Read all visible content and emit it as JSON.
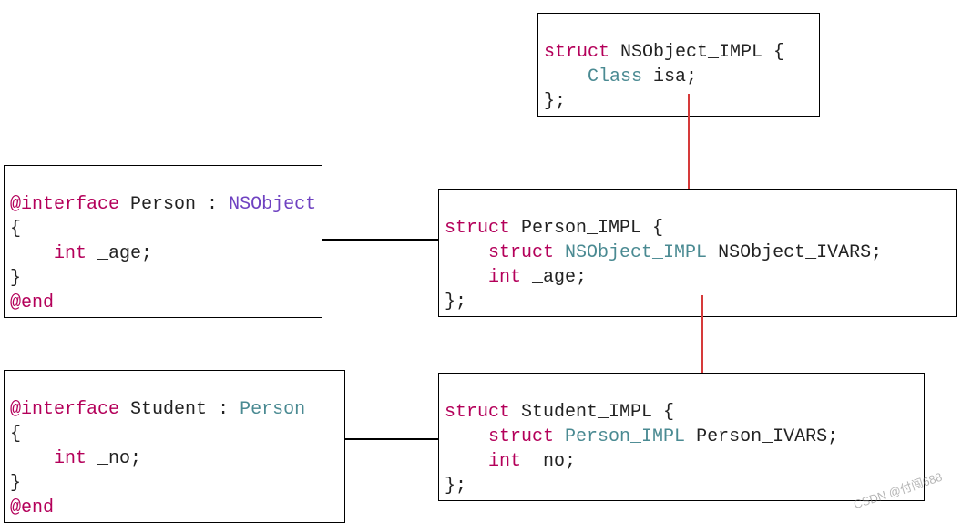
{
  "boxes": {
    "nsobject_impl": {
      "l1_struct": "struct",
      "l1_name": " NSObject_IMPL ",
      "l1_brace": "{",
      "l2_indent": "    ",
      "l2_type": "Class",
      "l2_ident": " isa;",
      "l3": "};"
    },
    "person_iface": {
      "l1_at": "@interface",
      "l1_name": " Person ",
      "l1_colon": ": ",
      "l1_super": "NSObject",
      "l2": "{",
      "l3_indent": "    ",
      "l3_kw": "int",
      "l3_ident": " _age;",
      "l4": "}",
      "l5_at": "@end"
    },
    "person_impl": {
      "l1_struct": "struct",
      "l1_name": " Person_IMPL ",
      "l1_brace": "{",
      "l2_indent": "    ",
      "l2_struct": "struct",
      "l2_type": " NSObject_IMPL",
      "l2_ident": " NSObject_IVARS;",
      "l3_indent": "    ",
      "l3_kw": "int",
      "l3_ident": " _age;",
      "l4": "};"
    },
    "student_iface": {
      "l1_at": "@interface",
      "l1_name": " Student ",
      "l1_colon": ": ",
      "l1_super": "Person",
      "l2": "{",
      "l3_indent": "    ",
      "l3_kw": "int",
      "l3_ident": " _no;",
      "l4": "}",
      "l5_at": "@end"
    },
    "student_impl": {
      "l1_struct": "struct",
      "l1_name": " Student_IMPL ",
      "l1_brace": "{",
      "l2_indent": "    ",
      "l2_struct": "struct",
      "l2_type": " Person_IMPL",
      "l2_ident": " Person_IVARS;",
      "l3_indent": "    ",
      "l3_kw": "int",
      "l3_ident": " _no;",
      "l4": "};"
    }
  },
  "watermark": "CSDN @付闯688"
}
